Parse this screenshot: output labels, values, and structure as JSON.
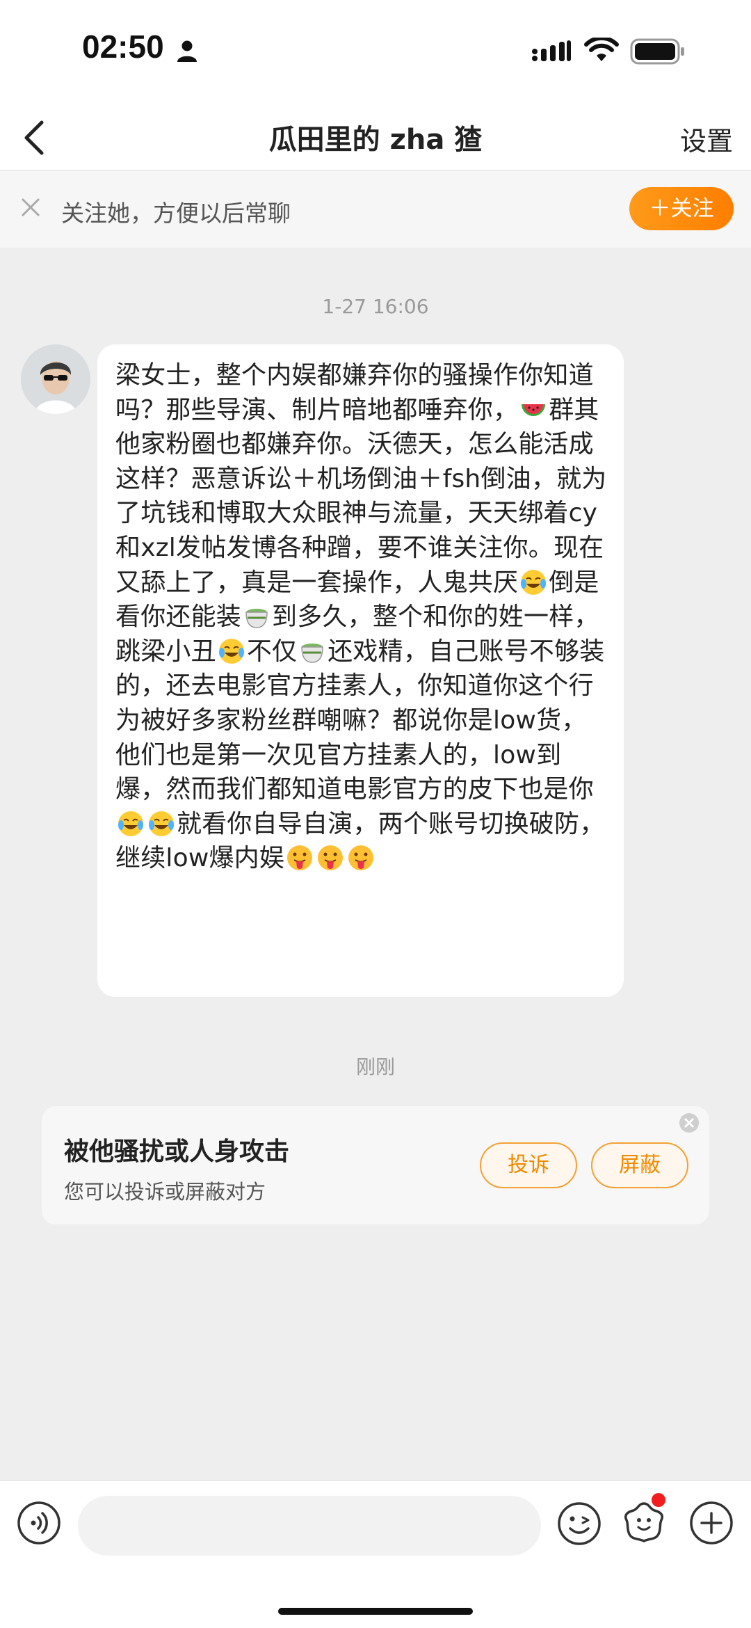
{
  "status_bar": {
    "time": "02:50"
  },
  "nav": {
    "title": "瓜田里的 zha 猹",
    "settings_label": "设置"
  },
  "follow_bar": {
    "hint": "关注她，方便以后常聊",
    "follow_label": "＋关注"
  },
  "chat": {
    "timestamp_1": "1-27 16:06",
    "message_segments": [
      "梁女士，整个内娱都嫌弃你的骚操作你知道吗？那些导演、制片暗地都唾弃你，",
      "群其他家粉圈也都嫌弃你。沃德天，怎么能活成这样？恶意诉讼＋机场倒油＋fsh倒油，就为了坑钱和博取大众眼神与流量，天天绑着cy和xzl发帖发博各种蹭，要不谁关注你。现在又舔上了，真是一套操作，人鬼共厌",
      "倒是看你还能装",
      "到多久，整个和你的姓一样，跳梁小丑",
      "不仅",
      "还戏精，自己账号不够装的，还去电影官方挂素人，你知道你这个行为被好多家粉丝群嘲嘛？都说你是low货，他们也是第一次见官方挂素人的，low到爆，然而我们都知道电影官方的皮下也是你",
      "就看你自导自演，两个账号切换破防，继续low爆内娱"
    ],
    "emojis": [
      "watermelon",
      "laugh-cry",
      "tea",
      "laugh-cry",
      "tea",
      "laugh-cry",
      "laugh-cry",
      "tongue-out",
      "tongue-out",
      "tongue-out"
    ],
    "timestamp_2": "刚刚"
  },
  "report_card": {
    "title": "被他骚扰或人身攻击",
    "subtitle": "您可以投诉或屏蔽对方",
    "complain_label": "投诉",
    "block_label": "屏蔽"
  },
  "input": {
    "placeholder": ""
  },
  "colors": {
    "accent": "#ff8a00",
    "notification": "#f21d1d"
  }
}
